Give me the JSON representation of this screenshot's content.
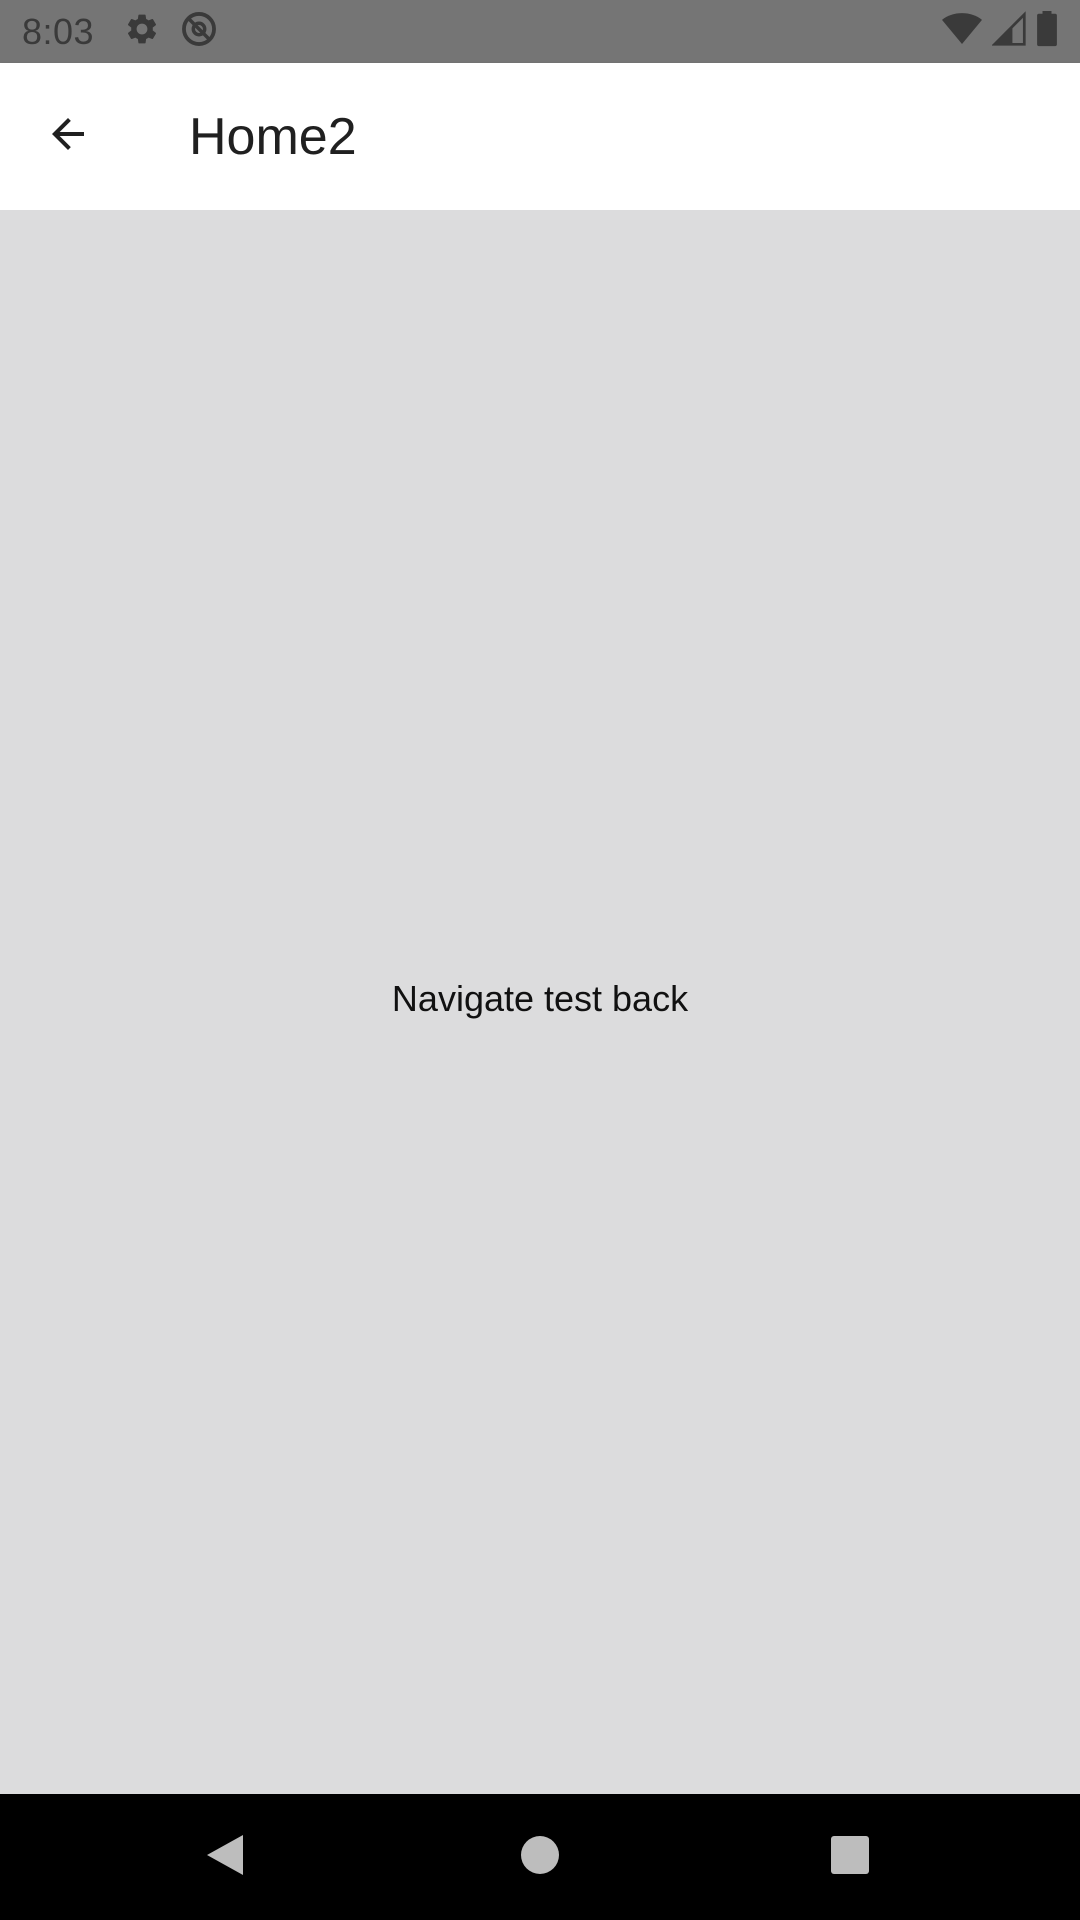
{
  "status_bar": {
    "time": "8:03",
    "icons_left": [
      "gear-icon",
      "at-sign-icon"
    ],
    "icons_right": [
      "wifi-icon",
      "signal-icon",
      "battery-icon"
    ]
  },
  "app_bar": {
    "title": "Home2",
    "back_icon": "arrow-back-icon"
  },
  "content": {
    "message": "Navigate test back"
  },
  "nav_bar": {
    "buttons": [
      "back-triangle-icon",
      "home-circle-icon",
      "recents-square-icon"
    ]
  },
  "colors": {
    "status_bar_bg": "#757575",
    "app_bar_bg": "#ffffff",
    "content_bg": "#dcdcdd",
    "nav_bar_bg": "#000000"
  }
}
